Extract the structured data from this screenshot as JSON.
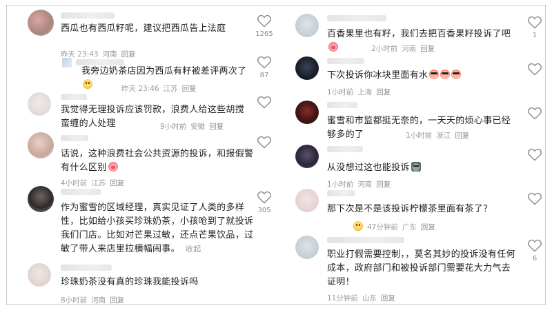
{
  "colors": {
    "text": "#1f1f1f",
    "meta": "#9a9a9a",
    "border": "#c9c9c9",
    "heart": "#8c8c8c"
  },
  "left_comments": [
    {
      "text": "西瓜也有西瓜籽呢，建议把西瓜告上法庭",
      "time": "昨天 23:43",
      "location": "河南",
      "reply": "回复",
      "likes": "1265"
    },
    {
      "text": "我旁边奶茶店因为西瓜有籽被差评两次了",
      "time": "昨天 23:46",
      "location": "江苏",
      "reply": "回复",
      "likes": "87",
      "emoji": "smile-face"
    },
    {
      "text": "我觉得无理投诉应该罚款，浪费人给这些胡搅蛮缠的人处理",
      "time": "9小时前",
      "location": "安徽",
      "reply": "回复",
      "likes": ""
    },
    {
      "text": "话说，这种浪费社会公共资源的投诉，和报假警有什么区别",
      "time": "4小时前",
      "location": "江苏",
      "reply": "回复",
      "likes": "",
      "emoji": "pig-face"
    },
    {
      "text": "作为蜜雪的区域经理，真实见证了人类的多样性，比如给小孩买珍珠奶茶，小孩呛到了就投诉我们门店。比如对芒果过敏，还点芒果饮品，过敏了带人来店里拉横幅闹事。",
      "collapse": "收起",
      "likes": "305"
    },
    {
      "text": "珍珠奶茶没有真的珍珠我能投诉吗",
      "time": "8小时前",
      "location": "河南",
      "reply": "回复",
      "likes": ""
    }
  ],
  "right_comments": [
    {
      "text": "百香果里也有籽，我们去把百香果籽投诉了吧",
      "time": "2小时前",
      "location": "河南",
      "reply": "回复",
      "likes": "1",
      "emoji": "pig-face"
    },
    {
      "text": "下次投诉你冰块里面有水",
      "time": "1小时前",
      "location": "上海",
      "reply": "回复",
      "likes": "",
      "emoji": "cool-face x3"
    },
    {
      "text": "蜜雪和市监都挺无奈的，一天天的烦心事已经够多的了",
      "time": "1小时前",
      "location": "浙江",
      "reply": "回复",
      "likes": ""
    },
    {
      "text": "从没想过这也能投诉",
      "time": "1小时前",
      "location": "河南",
      "reply": "回复",
      "likes": "",
      "emoji": "cat-face"
    },
    {
      "text": "那下次是不是该投诉柠檬茶里面有茶了？",
      "time": "47分钟前",
      "location": "广东",
      "reply": "回复",
      "likes": "",
      "emoji": "smile-face"
    },
    {
      "text": "职业打假需要控制，，莫名其妙的投诉没有任何成本，政府部门和被投诉部门需要花大力气去证明！",
      "time": "11分钟前",
      "location": "山东",
      "reply": "回复",
      "likes": "6"
    }
  ],
  "icons": {
    "like": "heart-outline-icon"
  }
}
